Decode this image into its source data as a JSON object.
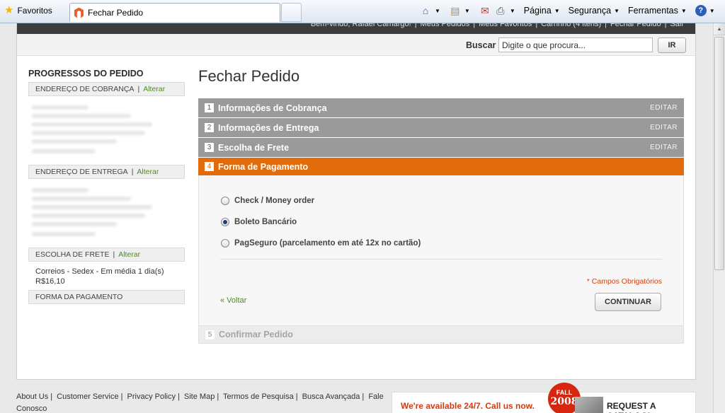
{
  "browser": {
    "favorites_label": "Favoritos",
    "tab_title": "Fechar Pedido",
    "tools": {
      "pagina": "Página",
      "seguranca": "Segurança",
      "ferramentas": "Ferramentas"
    }
  },
  "header": {
    "welcome": "Bem-vindo, Rafael Camargo!",
    "links": [
      "Meus Pedidos",
      "Meus Favoritos",
      "Carrinho (4 itens)",
      "Fechar Pedido",
      "Sair"
    ],
    "search_label": "Buscar",
    "search_placeholder": "Digite o que procura...",
    "search_button": "IR"
  },
  "sidebar": {
    "title": "PROGRESSOS DO PEDIDO",
    "change_label": "Alterar",
    "sections": {
      "cobranca": "ENDEREÇO DE COBRANÇA",
      "entrega": "ENDEREÇO DE ENTREGA",
      "frete": "ESCOLHA DE FRETE",
      "pagamento": "FORMA DA PAGAMENTO"
    },
    "frete_text": "Correios - Sedex - Em média 1 dia(s)",
    "frete_price": "R$16,10"
  },
  "main": {
    "title": "Fechar Pedido",
    "edit_label": "EDITAR",
    "steps": [
      {
        "num": "1",
        "label": "Informações de Cobrança"
      },
      {
        "num": "2",
        "label": "Informações de Entrega"
      },
      {
        "num": "3",
        "label": "Escolha de Frete"
      },
      {
        "num": "4",
        "label": "Forma de Pagamento"
      },
      {
        "num": "5",
        "label": "Confirmar Pedido"
      }
    ],
    "payment_options": [
      "Check / Money order",
      "Boleto Bancário",
      "PagSeguro (parcelamento em até 12x no cartão)"
    ],
    "selected_option": "Boleto Bancário",
    "required_note": "* Campos Obrigatórios",
    "back_link": "« Voltar",
    "continue_button": "CONTINUAR"
  },
  "footer": {
    "links": [
      "About Us",
      "Customer Service",
      "Privacy Policy",
      "Site Map",
      "Termos de Pesquisa",
      "Busca Avançada",
      "Fale Conosco"
    ],
    "promo_text": "We're available 24/7. Call us now.",
    "badge_line1": "FALL",
    "badge_line2": "2008",
    "catalog": "REQUEST A CATALOG!"
  }
}
